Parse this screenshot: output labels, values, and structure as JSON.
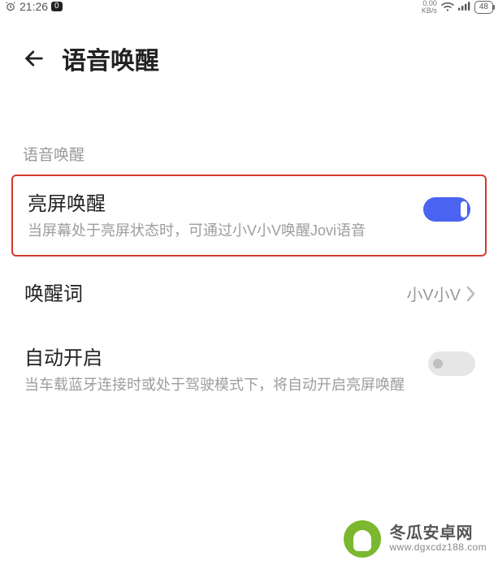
{
  "statusbar": {
    "time": "21:26",
    "badge": "0",
    "net_top": "0.00",
    "net_bottom": "KB/s",
    "battery": "48"
  },
  "header": {
    "title": "语音唤醒"
  },
  "section": {
    "label": "语音唤醒"
  },
  "rows": {
    "screen_wake": {
      "title": "亮屏唤醒",
      "desc": "当屏幕处于亮屏状态时，可通过小V小V唤醒Jovi语音",
      "on": true
    },
    "wakeword": {
      "title": "唤醒词",
      "value": "小V小V"
    },
    "auto_on": {
      "title": "自动开启",
      "desc": "当车载蓝牙连接时或处于驾驶模式下，将自动开启亮屏唤醒",
      "on": false
    }
  },
  "watermark": {
    "cn": "冬瓜安卓网",
    "en": "www.dgxcdz188.com"
  }
}
